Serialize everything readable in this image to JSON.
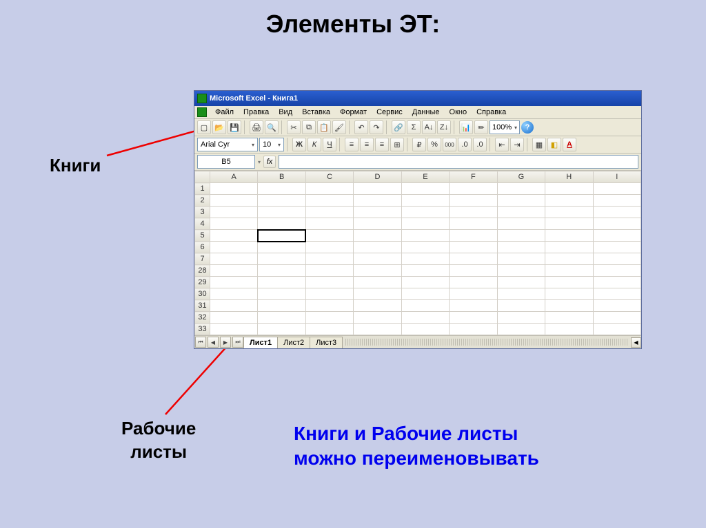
{
  "slide": {
    "title": "Элементы ЭТ:",
    "label_books": "Книги",
    "label_sheets_line1": "Рабочие",
    "label_sheets_line2": "листы",
    "note_line1": "Книги и Рабочие листы",
    "note_line2": "можно переименовывать"
  },
  "excel": {
    "title": "Microsoft Excel - Книга1",
    "menus": [
      "Файл",
      "Правка",
      "Вид",
      "Вставка",
      "Формат",
      "Сервис",
      "Данные",
      "Окно",
      "Справка"
    ],
    "font_name": "Arial Cyr",
    "font_size": "10",
    "zoom": "100%",
    "name_box": "B5",
    "fx_label": "fx",
    "columns": [
      "A",
      "B",
      "C",
      "D",
      "E",
      "F",
      "G",
      "H",
      "I"
    ],
    "rows": [
      "1",
      "2",
      "3",
      "4",
      "5",
      "6",
      "7",
      "28",
      "29",
      "30",
      "31",
      "32",
      "33"
    ],
    "selected_cell_row": "5",
    "selected_cell_col": "B",
    "sheets": [
      "Лист1",
      "Лист2",
      "Лист3"
    ],
    "active_sheet": "Лист1",
    "format_buttons": {
      "bold": "Ж",
      "italic": "К",
      "underline": "Ч"
    },
    "currency": "%",
    "thousands": "000",
    "help": "?"
  }
}
